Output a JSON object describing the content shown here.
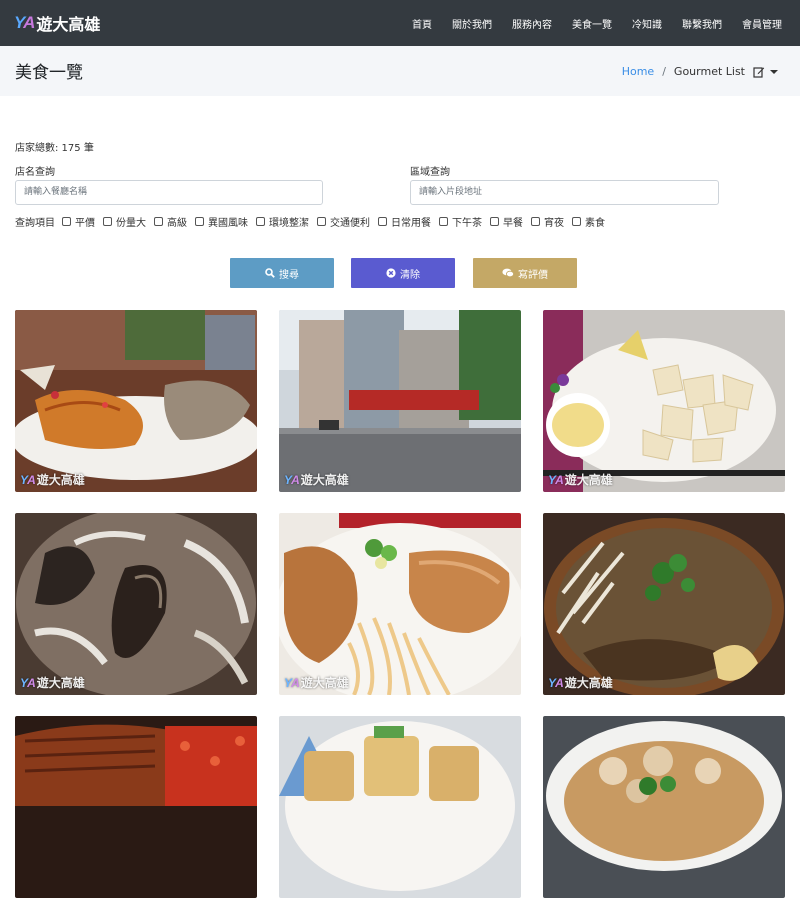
{
  "navbar": {
    "brand_text": "遊大高雄",
    "items": [
      "首頁",
      "關於我們",
      "服務內容",
      "美食一覽",
      "冷知識",
      "聯繫我們",
      "會員管理"
    ]
  },
  "header": {
    "title": "美食一覽",
    "breadcrumb_home": "Home",
    "breadcrumb_sep": "/",
    "breadcrumb_current": "Gourmet List"
  },
  "search": {
    "count_text": "店家總數: 175 筆",
    "name_label": "店名查詢",
    "name_placeholder": "請輸入餐廳名稱",
    "area_label": "區域查詢",
    "area_placeholder": "請輸入片段地址",
    "filter_label": "查詢項目",
    "filters": [
      "平價",
      "份量大",
      "高級",
      "異國風味",
      "環境整潔",
      "交通便利",
      "日常用餐",
      "下午茶",
      "早餐",
      "宵夜",
      "素食"
    ]
  },
  "buttons": {
    "search": "搜尋",
    "clear": "清除",
    "review": "寫評價"
  },
  "cards": {
    "watermark": "遊大高雄",
    "count": 9
  },
  "colors": {
    "navbar": "#343a40",
    "search_button": "#5d9cc5",
    "clear_button": "#5a5bd0",
    "review_button": "#c4a866",
    "link": "#3a8ee6"
  }
}
